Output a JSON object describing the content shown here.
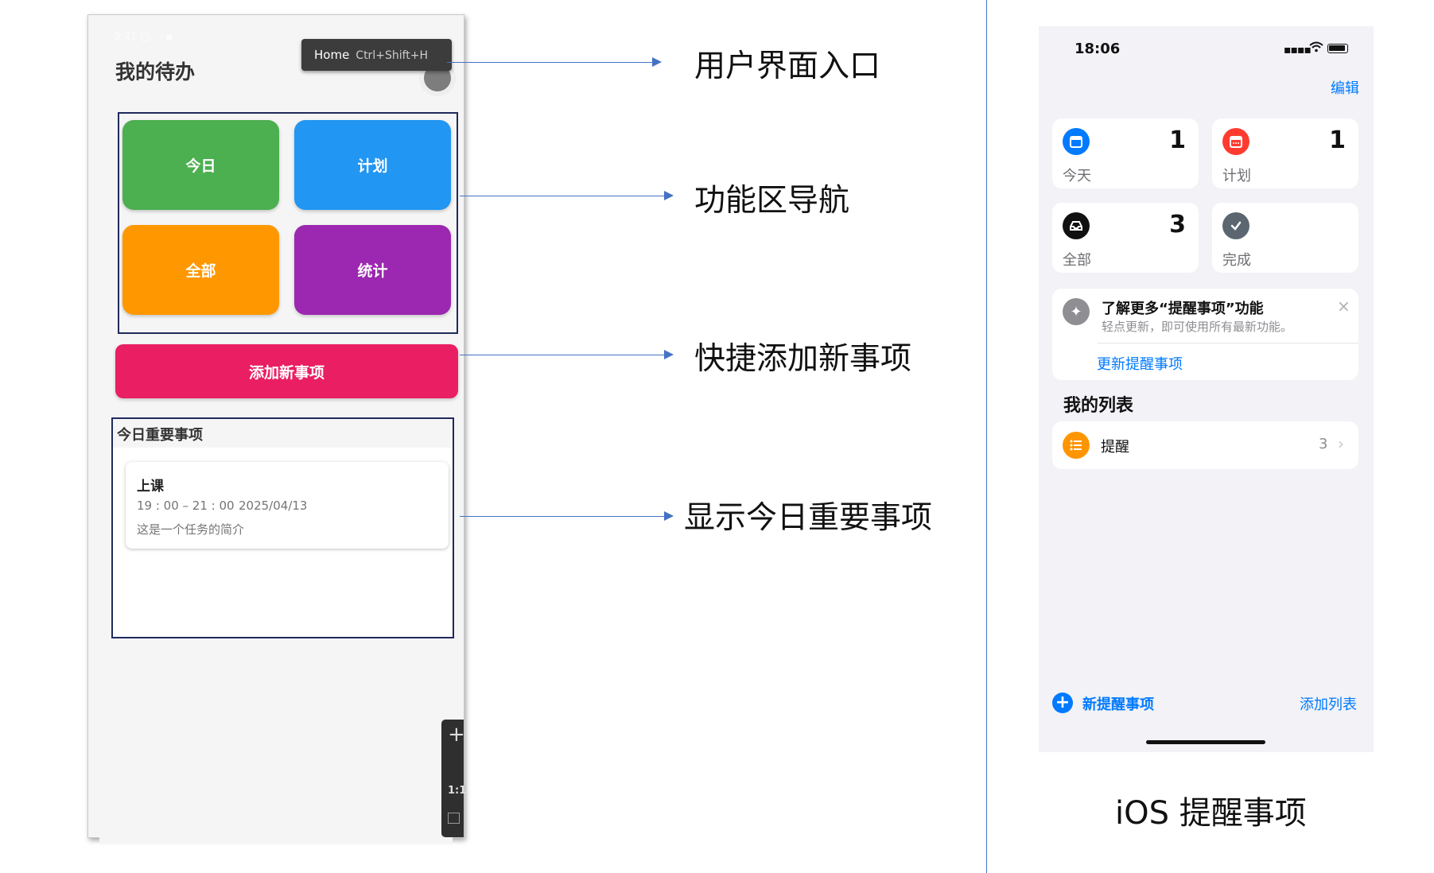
{
  "app": {
    "title": "我的待办",
    "status_mini": "9:41 ▢ ◌ ▪",
    "tooltip": {
      "label": "Home",
      "shortcut": "Ctrl+Shift+H"
    },
    "nav": {
      "today": "今日",
      "plan": "计划",
      "all": "全部",
      "stats": "统计"
    },
    "add_button": "添加新事项",
    "today_section": {
      "title": "今日重要事项",
      "task": {
        "name": "上课",
        "time": "19 : 00 – 21 : 00",
        "date": "2025/04/13",
        "desc": "这是一个任务的简介"
      }
    },
    "zoom": {
      "plus": "+",
      "ratio": "1:1"
    },
    "colors": {
      "today": "#4caf50",
      "plan": "#2196f3",
      "all": "#ff9800",
      "stats": "#9c27b0",
      "add": "#e91e63"
    }
  },
  "annotations": [
    "用户界面入口",
    "功能区导航",
    "快捷添加新事项",
    "显示今日重要事项"
  ],
  "ios": {
    "caption": "iOS 提醒事项",
    "status_time": "18:06",
    "edit": "编辑",
    "cards": {
      "today": {
        "label": "今天",
        "count": "1",
        "icon": "calendar-icon",
        "color": "#007aff"
      },
      "plan": {
        "label": "计划",
        "count": "1",
        "icon": "calendar-grid-icon",
        "color": "#ff3b30"
      },
      "all": {
        "label": "全部",
        "count": "3",
        "icon": "tray-icon",
        "color": "#111111"
      },
      "done": {
        "label": "完成",
        "count": "",
        "icon": "checkmark-icon",
        "color": "#5b6670"
      }
    },
    "tip": {
      "title": "了解更多“提醒事项”功能",
      "subtitle": "轻点更新，即可使用所有最新功能。",
      "link": "更新提醒事项",
      "close": "×"
    },
    "my_lists": {
      "title": "我的列表",
      "items": [
        {
          "name": "提醒",
          "count": "3"
        }
      ]
    },
    "footer": {
      "new_reminder": "新提醒事项",
      "add_list": "添加列表"
    }
  }
}
